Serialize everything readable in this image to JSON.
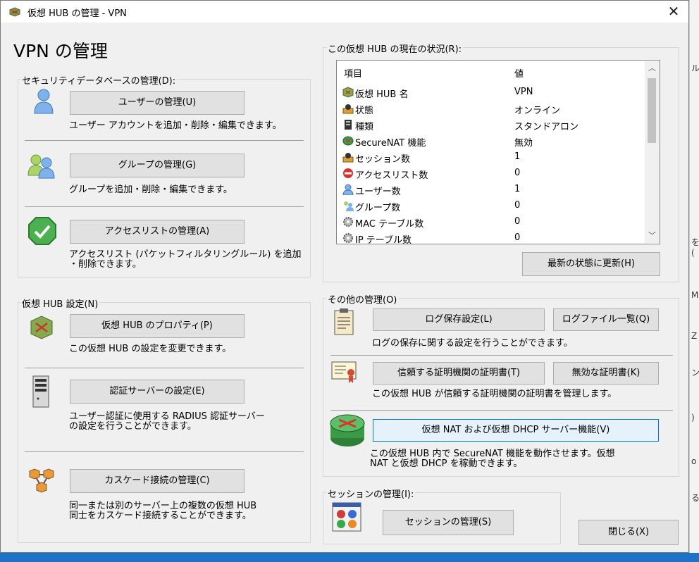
{
  "window": {
    "title": "仮想 HUB の管理 - VPN",
    "close_symbol": "✕"
  },
  "main_heading": "VPN の管理",
  "security_db": {
    "label": "セキュリティデータベースの管理(D):",
    "users": {
      "button": "ユーザーの管理(U)",
      "desc": "ユーザー アカウントを追加・削除・編集できます。",
      "icon": "user-icon"
    },
    "groups": {
      "button": "グループの管理(G)",
      "desc": "グループを追加・削除・編集できます。",
      "icon": "group-icon"
    },
    "access": {
      "button": "アクセスリストの管理(A)",
      "desc_line1": "アクセスリスト (パケットフィルタリングルール) を追加",
      "desc_line2": "・削除できます。",
      "icon": "check-shield-icon"
    }
  },
  "hub_settings": {
    "label": "仮想 HUB 設定(N)",
    "properties": {
      "button": "仮想 HUB のプロパティ(P)",
      "desc": "この仮想 HUB の設定を変更できます。",
      "icon": "hub-icon"
    },
    "radius": {
      "button": "認証サーバーの設定(E)",
      "desc_line1": "ユーザー認証に使用する RADIUS 認証サーバー",
      "desc_line2": "の設定を行うことができます。",
      "icon": "server-tower-icon"
    },
    "cascade": {
      "button": "カスケード接続の管理(C)",
      "desc_line1": "同一または別のサーバー上の複数の仮想 HUB",
      "desc_line2": "同士をカスケード接続することができます。",
      "icon": "cascade-network-icon"
    }
  },
  "status": {
    "label": "この仮想 HUB の現在の状況(R):",
    "col_item": "項目",
    "col_value": "値",
    "rows": [
      {
        "name": "仮想 HUB 名",
        "value": "VPN",
        "icon": "hub-icon"
      },
      {
        "name": "状態",
        "value": "オンライン",
        "icon": "status-icon"
      },
      {
        "name": "種類",
        "value": "スタンドアロン",
        "icon": "server-icon"
      },
      {
        "name": "SecureNAT 機能",
        "value": "無効",
        "icon": "securenat-icon"
      },
      {
        "name": "セッション数",
        "value": "1",
        "icon": "session-icon"
      },
      {
        "name": "アクセスリスト数",
        "value": "0",
        "icon": "no-entry-icon"
      },
      {
        "name": "ユーザー数",
        "value": "1",
        "icon": "user-icon"
      },
      {
        "name": "グループ数",
        "value": "0",
        "icon": "group-icon"
      },
      {
        "name": "MAC テーブル数",
        "value": "0",
        "icon": "gear-icon"
      },
      {
        "name": "IP テーブル数",
        "value": "0",
        "icon": "gear-icon"
      }
    ],
    "refresh_button": "最新の状態に更新(H)"
  },
  "other": {
    "label": "その他の管理(O)",
    "log_settings_button": "ログ保存設定(L)",
    "log_files_button": "ログファイル一覧(Q)",
    "log_desc": "ログの保存に関する設定を行うことができます。",
    "trusted_ca_button": "信頼する証明機関の証明書(T)",
    "invalid_cert_button": "無効な証明書(K)",
    "cert_desc": "この仮想 HUB が信頼する証明機関の証明書を管理します。",
    "nat_button": "仮想 NAT および仮想 DHCP サーバー機能(V)",
    "nat_desc_line1": "この仮想 HUB 内で SecureNAT 機能を動作させます。仮想",
    "nat_desc_line2": "NAT と仮想 DHCP を稼動できます。"
  },
  "sessions": {
    "label": "セッションの管理(I):",
    "button": "セッションの管理(S)"
  },
  "close_button": "閉じる(X)",
  "background_window": {
    "fragments": [
      "ル",
      "を(",
      "M",
      "Z",
      "ン",
      ")",
      "o",
      "る"
    ]
  },
  "colors": {
    "accent": "#0078d7",
    "window_bg": "#f0f0f0",
    "taskbar": "#1e72c8"
  }
}
